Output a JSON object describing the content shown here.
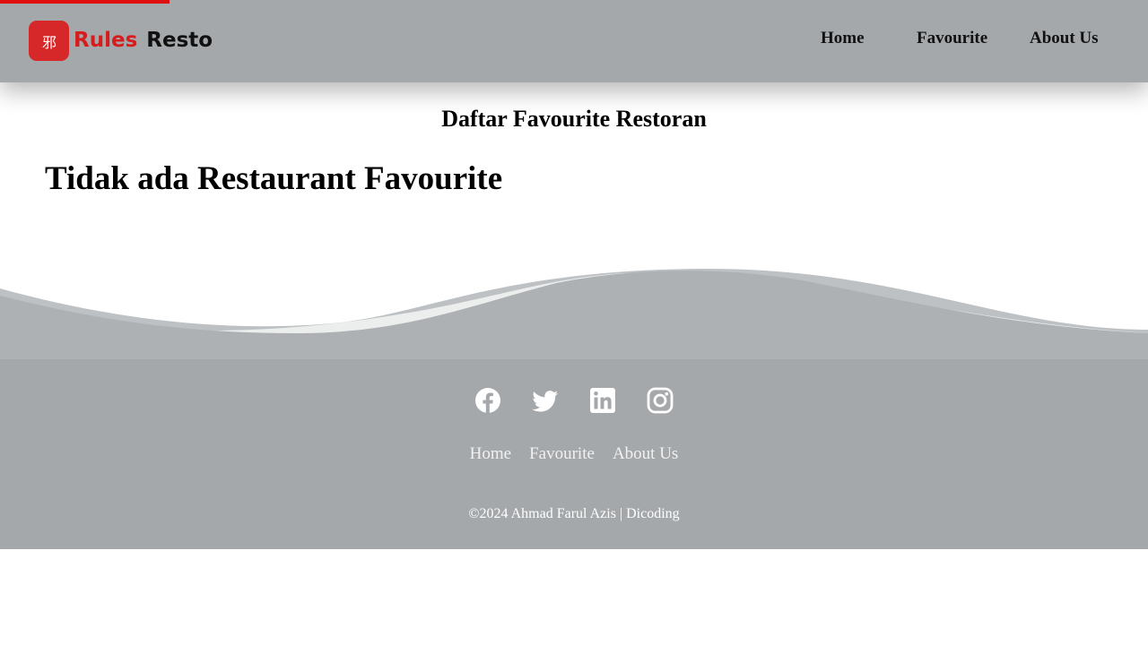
{
  "brand": {
    "logo_glyph": "邪",
    "name_first": "Rules",
    "name_second": "Resto"
  },
  "nav": {
    "home": "Home",
    "favourite": "Favourite",
    "about": "About Us"
  },
  "main": {
    "heading": "Daftar Favourite Restoran",
    "empty_message": "Tidak ada Restaurant Favourite"
  },
  "footer": {
    "socials": [
      "facebook-icon",
      "twitter-icon",
      "linkedin-icon",
      "instagram-icon"
    ],
    "links": {
      "home": "Home",
      "favourite": "Favourite",
      "about": "About Us"
    },
    "copyright": "©2024 Ahmad Farul Azis | Dicoding"
  },
  "colors": {
    "accent": "#d62828",
    "header_bg": "#a5a8ab",
    "footer_bg": "#a5a8ab",
    "progress": "#e01010"
  }
}
